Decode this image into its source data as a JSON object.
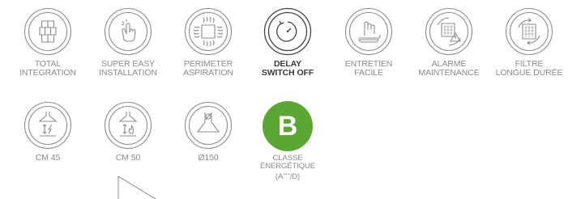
{
  "row1": [
    {
      "icon": "grid-icon",
      "label": "TOTAL\nINTEGRATION"
    },
    {
      "icon": "hand-tap-icon",
      "label": "SUPER EASY\nINSTALLATION"
    },
    {
      "icon": "perimeter-aspiration-icon",
      "label": "PERIMETER\nASPIRATION"
    },
    {
      "icon": "delay-timer-icon",
      "label": "DELAY\nSWITCH OFF"
    },
    {
      "icon": "hand-cleaning-icon",
      "label": "ENTRETIEN\nFACILE"
    },
    {
      "icon": "filter-alarm-icon",
      "label": "ALARME\nMAINTENANCE"
    },
    {
      "icon": "filter-cycle-icon",
      "label": "FILTRE\nLONGUE DURÉE"
    }
  ],
  "row2": [
    {
      "icon": "hood-height-45-icon",
      "label": "CM 45"
    },
    {
      "icon": "hood-height-50-icon",
      "label": "CM 50"
    },
    {
      "icon": "duct-diameter-icon",
      "label": "Ø150"
    }
  ],
  "energy": {
    "grade": "B",
    "line1": "CLASSE",
    "line2": "ÉNERGÉTIQUE",
    "line3": "(A",
    "sup": "+++",
    "line3_end": "/D)",
    "badge_color": "#5aa832"
  }
}
